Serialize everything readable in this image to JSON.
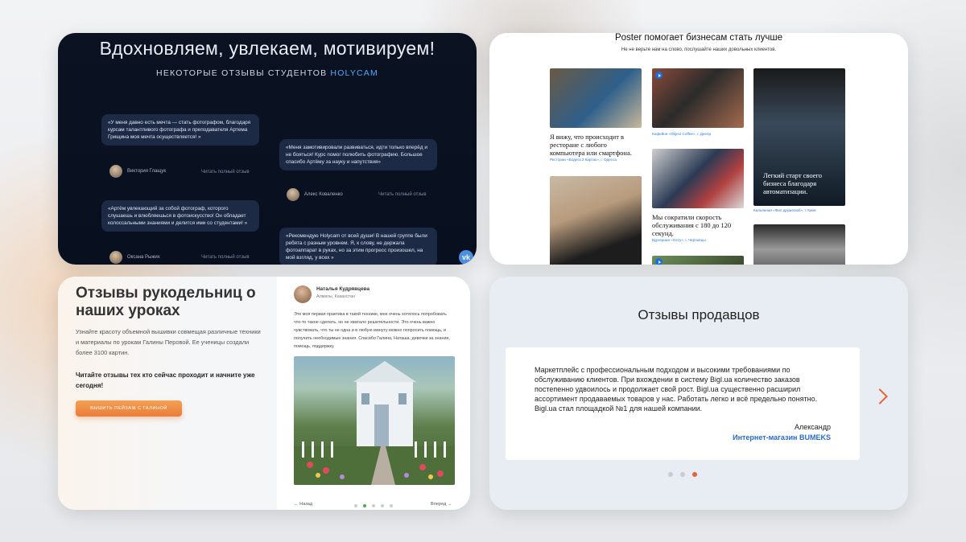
{
  "card1": {
    "title": "Вдохновляем, увлекаем, мотивируем!",
    "subtitle_prefix": "НЕКОТОРЫЕ ОТЗЫВЫ СТУДЕНТОВ ",
    "subtitle_brand": "HOLYCAM",
    "reviews": [
      {
        "text": "«У меня давно есть мечта — стать фотографом, благодаря курсам талантливого фотографа и преподавателя Артема Грищина моя мечта осуществляется! »",
        "author": "Виктория Глащук",
        "link": "Читать полный отзыв"
      },
      {
        "text": "«Меня замотивировали развиваться, идти только вперёд и не бояться! Курс помог полюбить фотографию. Большое спасибо Артёму за науку и напутствия»",
        "author": "Алекс Коваленко",
        "link": "Читать полный отзыв"
      },
      {
        "text": "«Артём увлекающий за собой фотограф, которого слушаешь и влюбляешься в фотоискусство! Он обладает колоссальными знаниями и делится ими со студентами! »",
        "author": "Оксана Рыжих",
        "link": "Читать полный отзыв"
      },
      {
        "text": "«Рекомендую Holycam от всей души! В нашей группе были ребята с разным уровнем. Я, к слову, не держала фотоаппарат в руках, но за этим прогресс произошел, на мой взгляд, у всех »",
        "author": "",
        "link": ""
      }
    ],
    "vk": "vk"
  },
  "card2": {
    "title": "Poster помогает бизнесам стать лучше",
    "subtitle": "Не не верьте нам на слово, послушайте наших довольных клиентов.",
    "items": [
      {
        "caption": "Я вижу, что происходит в ресторане с любого компьютера или смартфона.",
        "link": "Ресторан «Бодега 2 Картах», г. Одесса"
      },
      {
        "caption": "",
        "link": "Кофейня «Object Coffee», г. Днепр"
      },
      {
        "caption": "Мы сократили скорость обслуживания с 180 до 120 секунд.",
        "link": "Бургерная «Ozzy», г. Черновцы"
      },
      {
        "caption": "Легкий старт своего бизнеса благодаря автоматизации.",
        "link": "Кальянная «Фил дружелюб», г. Киев"
      }
    ]
  },
  "card3": {
    "title": "Отзывы рукодельниц о наших уроках",
    "description": "Узнайте красоту объемной вышивки совмещая различные техники и материалы по урокам Галины Перовой. Ее ученицы создали более 3100 картин.",
    "bold": "Читайте отзывы тех кто сейчас проходит и начните уже сегодня!",
    "button": "ВЫШИТЬ ПЕЙЗАЖ С ГАЛИНОЙ",
    "review": {
      "name": "Наталья Кудрявцева",
      "location": "Алматы, Казахстан",
      "text": "Это моя первая практика в такой технике, мне очень хотелось попробовать что-то такое сделать, но не хватало решительности. Это очень важно чувствовать, что ты не одна и в любую минуту можно попросить помощь, и получить необходимые знания. Спасибо Галина, Наташа, девочки за знания, помощь, поддержку."
    },
    "prev": "Назад",
    "next": "Вперед"
  },
  "card4": {
    "title": "Отзывы продавцов",
    "quote": "Маркетплейс с профессиональным подходом и высокими требованиями по обслуживанию клиентов. При вхождении в систему Bigl.ua количество заказов постепенно удвоилось и продолжает свой рост. Bigl.ua существенно расширил ассортимент продаваемых товаров у нас. Работать легко и всё предельно понятно. Bigl.ua стал площадкой №1 для нашей компании.",
    "name": "Александр",
    "company": "Интернет-магазин BUMEKS",
    "accent": "#e8603a"
  }
}
